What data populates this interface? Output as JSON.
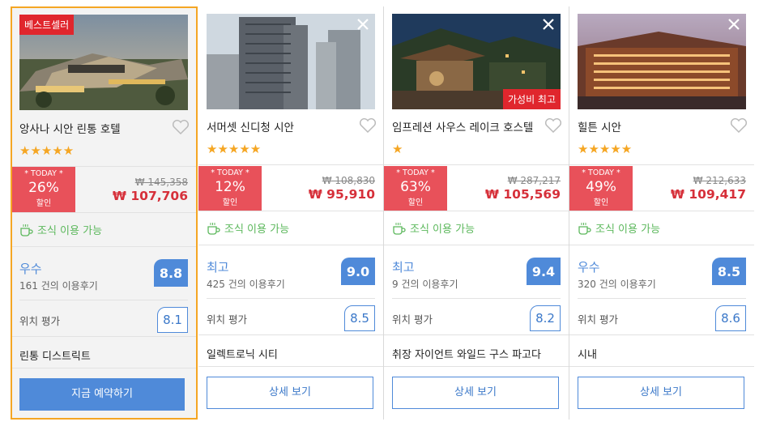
{
  "hotels": [
    {
      "name": "앙사나 시안 린통 호텔",
      "badge_top": "베스트셀러",
      "badge_bottom": "",
      "stars": "★★★★★",
      "today_label": "* TODAY *",
      "discount": "26%",
      "discount_sub": "할인",
      "original_price": "₩ 145,358",
      "price": "₩ 107,706",
      "breakfast": "조식 이용 가능",
      "rating_word": "우수",
      "reviews": "161 건의 이용후기",
      "score": "8.8",
      "location_label": "위치 평가",
      "location_score": "8.1",
      "district": "린통 디스트릭트",
      "button": "지금 예약하기",
      "image_icon": "hotel-resort-photo"
    },
    {
      "name": "서머셋 신디청 시안",
      "badge_top": "",
      "badge_bottom": "",
      "stars": "★★★★★",
      "today_label": "* TODAY *",
      "discount": "12%",
      "discount_sub": "할인",
      "original_price": "₩ 108,830",
      "price": "₩ 95,910",
      "breakfast": "조식 이용 가능",
      "rating_word": "최고",
      "reviews": "425 건의 이용후기",
      "score": "9.0",
      "location_label": "위치 평가",
      "location_score": "8.5",
      "district": "일렉트로닉 시티",
      "button": "상세 보기",
      "image_icon": "city-towers-photo"
    },
    {
      "name": "임프레션 사우스 레이크 호스텔",
      "badge_top": "",
      "badge_bottom": "가성비 최고",
      "stars": "★",
      "today_label": "* TODAY *",
      "discount": "63%",
      "discount_sub": "할인",
      "original_price": "₩ 287,217",
      "price": "₩ 105,569",
      "breakfast": "조식 이용 가능",
      "rating_word": "최고",
      "reviews": "9 건의 이용후기",
      "score": "9.4",
      "location_label": "위치 평가",
      "location_score": "8.2",
      "district": "취장 자이언트 와일드 구스 파고다",
      "button": "상세 보기",
      "image_icon": "chinese-garden-photo"
    },
    {
      "name": "힐튼 시안",
      "badge_top": "",
      "badge_bottom": "",
      "stars": "★★★★★",
      "today_label": "* TODAY *",
      "discount": "49%",
      "discount_sub": "할인",
      "original_price": "₩ 212,633",
      "price": "₩ 109,417",
      "breakfast": "조식 이용 가능",
      "rating_word": "우수",
      "reviews": "320 건의 이용후기",
      "score": "8.5",
      "location_label": "위치 평가",
      "location_score": "8.6",
      "district": "시내",
      "button": "상세 보기",
      "image_icon": "lit-hotel-night-photo"
    }
  ],
  "colors": {
    "accent_blue": "#4f8ad9",
    "discount_red": "#e8515a",
    "price_red": "#d6303a",
    "badge_red": "#e0262d",
    "breakfast_green": "#5cb85c",
    "highlight_orange": "#f5a623"
  }
}
